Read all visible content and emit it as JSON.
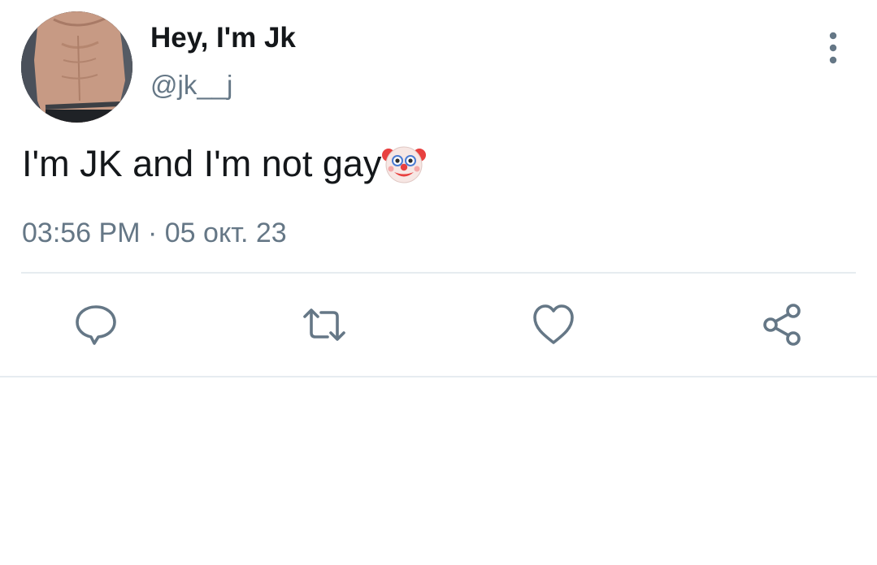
{
  "tweet": {
    "author": {
      "display_name": "Hey, I'm Jk",
      "handle": "@jk__j"
    },
    "text": "I'm JK and I'm not gay",
    "emoji": "clown-face-icon",
    "time": "03:56 PM",
    "separator": "·",
    "date": "05 окт. 23"
  },
  "actions": {
    "reply_icon": "speech-bubble-icon",
    "retweet_icon": "retweet-arrows-icon",
    "like_icon": "heart-icon",
    "share_icon": "share-nodes-icon",
    "more_icon": "vertical-dots-icon"
  },
  "colors": {
    "text_primary": "#14171a",
    "text_secondary": "#657786",
    "divider": "#e6ecf0",
    "icon": "#657786"
  }
}
